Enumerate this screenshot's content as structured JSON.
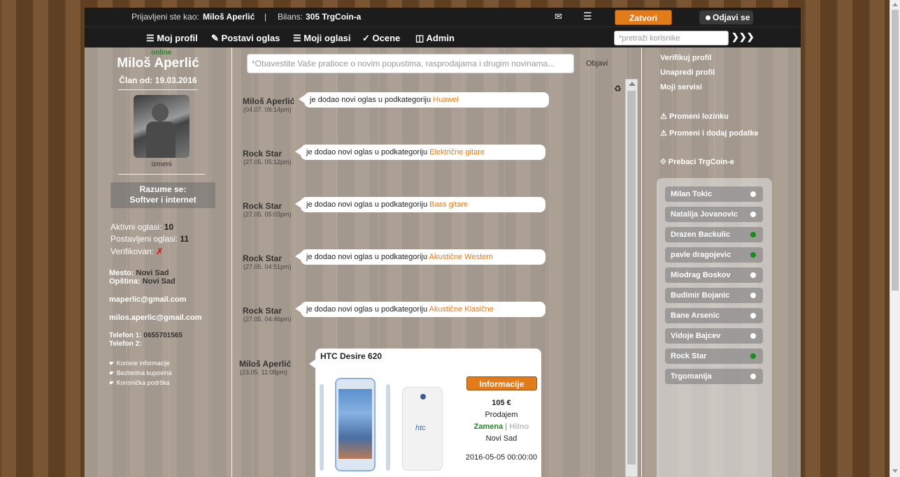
{
  "header": {
    "logged_prefix": "Prijavljeni ste kao:",
    "user_name": "Miloš Aperlić",
    "separator": "|",
    "balance_label": "Bilans:",
    "balance_value": "305 TrgCoin-a",
    "close_button": "Zatvori",
    "logout_button": "Odjavi se"
  },
  "nav": {
    "profile": "Moj profil",
    "post_ad": "Postavi oglas",
    "my_ads": "Moji oglasi",
    "ratings": "Ocene",
    "admin": "Admin",
    "search_placeholder": "*pretraži korisnike"
  },
  "profile": {
    "status": "online",
    "name": "Miloš Aperlić",
    "member_prefix": "Član od:",
    "member_since": "19.03.2016",
    "edit_link": "izmeni",
    "expertise_label": "Razume se:",
    "expertise_value": "Softver i internet",
    "active_ads_label": "Aktivni oglasi:",
    "active_ads_value": "10",
    "posted_ads_label": "Postavljeni oglasi:",
    "posted_ads_value": "11",
    "verified_label": "Verifikovan:",
    "verified_value": "✗",
    "city_label": "Mesto:",
    "city_value": "Novi Sad",
    "municipality_label": "Opština:",
    "municipality_value": "Novi Sad",
    "email1": "maperlic@gmail.com",
    "email2": "milos.aperlic@gmail.com",
    "phone1_label": "Telefon 1:",
    "phone1_value": "0655701565",
    "phone2_label": "Telefon 2:",
    "links": [
      "Korisne informacije",
      "Bezbedna kupovina",
      "Korisnička podrška"
    ]
  },
  "feed": {
    "post_placeholder": "*Obavestite Vaše pratioce o novim popustima, rasprodajama i drugim novinama...",
    "publish_button": "Objavi",
    "entry_text": "je dodao novi oglas u podkategoriju",
    "entries": [
      {
        "name": "Miloš Aperlić",
        "date": "(04.07. 08:14pm)",
        "category": "Huawei"
      },
      {
        "name": "Rock Star",
        "date": "(27.05. 05:12pm)",
        "category": "Električne gitare"
      },
      {
        "name": "Rock Star",
        "date": "(27.05. 05:03pm)",
        "category": "Bass gitare"
      },
      {
        "name": "Rock Star",
        "date": "(27.05. 04:51pm)",
        "category": "Akustične Western"
      },
      {
        "name": "Rock Star",
        "date": "(27.05. 04:46pm)",
        "category": "Akustične Klasične"
      }
    ],
    "card": {
      "name": "Miloš Aperlić",
      "date": "(23.05. 11:08pm)",
      "title": "HTC Desire 620",
      "info_button": "Informacije",
      "price": "105 €",
      "type": "Prodajem",
      "swap": "Zamena",
      "divider": "|",
      "urgent": "Hitno",
      "city": "Novi Sad",
      "datetime": "2016-05-05 00:00:00",
      "logo": "htc"
    }
  },
  "right": {
    "verify": "Verifikuj profil",
    "upgrade": "Unapredi profil",
    "services": "Moji servisi",
    "change_password": "Promeni lozinku",
    "change_data": "Promeni i dodaj podatke",
    "transfer": "Prebaci TrgCoin-e",
    "users": [
      {
        "name": "Milan Tokic",
        "online": false
      },
      {
        "name": "Natalija Jovanovic",
        "online": false
      },
      {
        "name": "Drazen Backulic",
        "online": true
      },
      {
        "name": "pavle dragojevic",
        "online": true
      },
      {
        "name": "Miodrag Boskov",
        "online": false
      },
      {
        "name": "Budimir Bojanic",
        "online": false
      },
      {
        "name": "Bane Arsenic",
        "online": false
      },
      {
        "name": "Vidoje Bajcev",
        "online": false
      },
      {
        "name": "Rock Star",
        "online": true
      },
      {
        "name": "Trgomanija",
        "online": false
      }
    ]
  },
  "colors": {
    "accent": "#e27b1a",
    "online": "#1d8a1d",
    "header": "#1c1c1c"
  }
}
